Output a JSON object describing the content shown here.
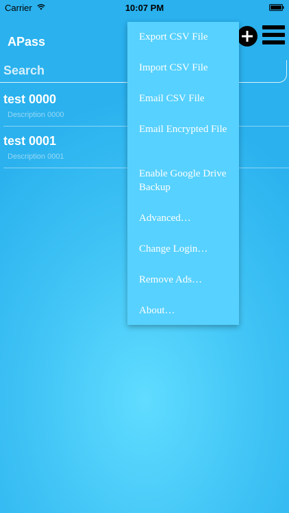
{
  "status_bar": {
    "carrier": "Carrier",
    "time": "10:07 PM",
    "wifi_icon": "wifi-icon",
    "battery_icon": "battery-icon"
  },
  "header": {
    "title": "APass",
    "add_icon": "plus-circle-icon",
    "menu_icon": "hamburger-icon"
  },
  "search": {
    "placeholder": "Search",
    "value": ""
  },
  "entries": [
    {
      "title": "test 0000",
      "description": "Description 0000"
    },
    {
      "title": "test 0001",
      "description": "Description 0001"
    }
  ],
  "menu": {
    "items": [
      "Export CSV File",
      "Import CSV File",
      "Email CSV File",
      "Email Encrypted File",
      "Enable Google Drive Backup",
      "Advanced…",
      "Change Login…",
      "Remove Ads…",
      "About…"
    ]
  },
  "colors": {
    "background": "#3fc3f5",
    "menu_background": "#57d1ff",
    "text": "#ffffff"
  }
}
